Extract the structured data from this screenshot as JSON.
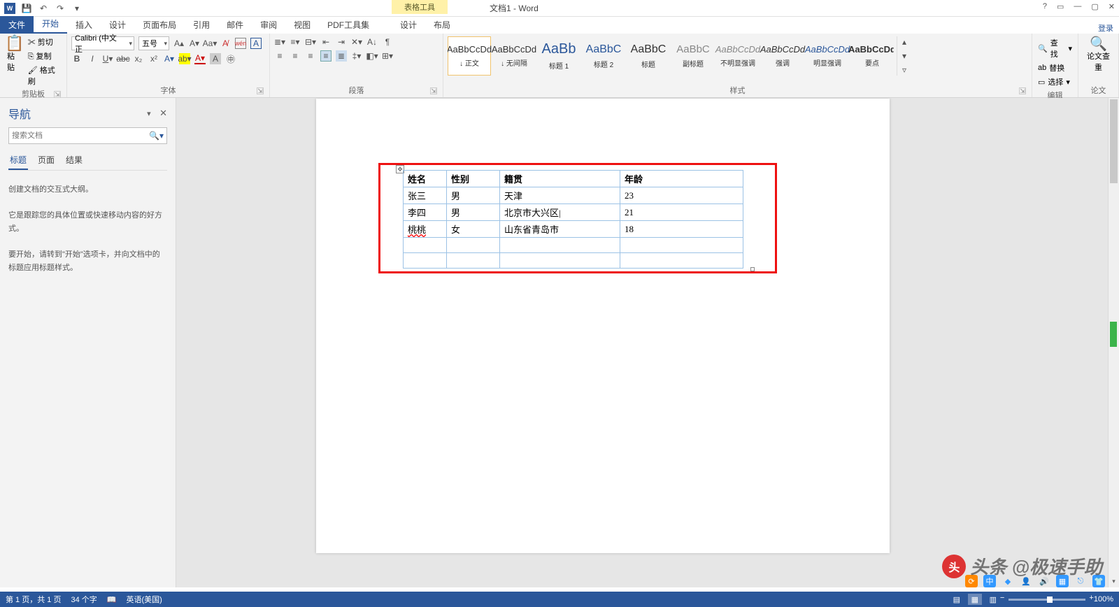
{
  "titlebar": {
    "context_tool": "表格工具",
    "doc_title": "文档1 - Word",
    "help": "?",
    "ribbon_opts": "▭",
    "min": "—",
    "max": "▢",
    "close": "✕"
  },
  "tabs": {
    "file": "文件",
    "items": [
      "开始",
      "插入",
      "设计",
      "页面布局",
      "引用",
      "邮件",
      "审阅",
      "视图",
      "PDF工具集"
    ],
    "ctx": [
      "设计",
      "布局"
    ],
    "login": "登录"
  },
  "ribbon": {
    "clipboard": {
      "paste": "粘贴",
      "cut": "剪切",
      "copy": "复制",
      "painter": "格式刷",
      "label": "剪贴板"
    },
    "font": {
      "name": "Calibri (中文正",
      "size": "五号",
      "label": "字体"
    },
    "para": {
      "label": "段落"
    },
    "styles": {
      "label": "样式",
      "items": [
        {
          "preview": "AaBbCcDd",
          "name": "↓ 正文"
        },
        {
          "preview": "AaBbCcDd",
          "name": "↓ 无间隔"
        },
        {
          "preview": "AaBb",
          "name": "标题 1"
        },
        {
          "preview": "AaBbC",
          "name": "标题 2"
        },
        {
          "preview": "AaBbC",
          "name": "标题"
        },
        {
          "preview": "AaBbC",
          "name": "副标题"
        },
        {
          "preview": "AaBbCcDd",
          "name": "不明显强调"
        },
        {
          "preview": "AaBbCcDd",
          "name": "强调"
        },
        {
          "preview": "AaBbCcDd",
          "name": "明显强调"
        },
        {
          "preview": "AaBbCcDd",
          "name": "要点"
        }
      ]
    },
    "editing": {
      "find": "查找",
      "replace": "替换",
      "select": "选择",
      "label": "编辑"
    },
    "thesis": {
      "btn": "论文查重",
      "label": "论文"
    }
  },
  "nav": {
    "title": "导航",
    "search_ph": "搜索文档",
    "tabs": [
      "标题",
      "页面",
      "结果"
    ],
    "p1": "创建文档的交互式大纲。",
    "p2": "它是跟踪您的具体位置或快速移动内容的好方式。",
    "p3": "要开始，请转到\"开始\"选项卡，并向文档中的标题应用标题样式。"
  },
  "table": {
    "headers": [
      "姓名",
      "性别",
      "籍贯",
      "年龄"
    ],
    "rows": [
      [
        "张三",
        "男",
        "天津",
        "23"
      ],
      [
        "李四",
        "男",
        "北京市大兴区",
        "21"
      ],
      [
        "桃桃",
        "女",
        "山东省青岛市",
        "18"
      ],
      [
        "",
        "",
        "",
        ""
      ],
      [
        "",
        "",
        "",
        ""
      ]
    ]
  },
  "status": {
    "page": "第 1 页，共 1 页",
    "words": "34 个字",
    "lang": "英语(美国)",
    "zoom": "100%"
  },
  "watermark": "头条 @极速手助"
}
